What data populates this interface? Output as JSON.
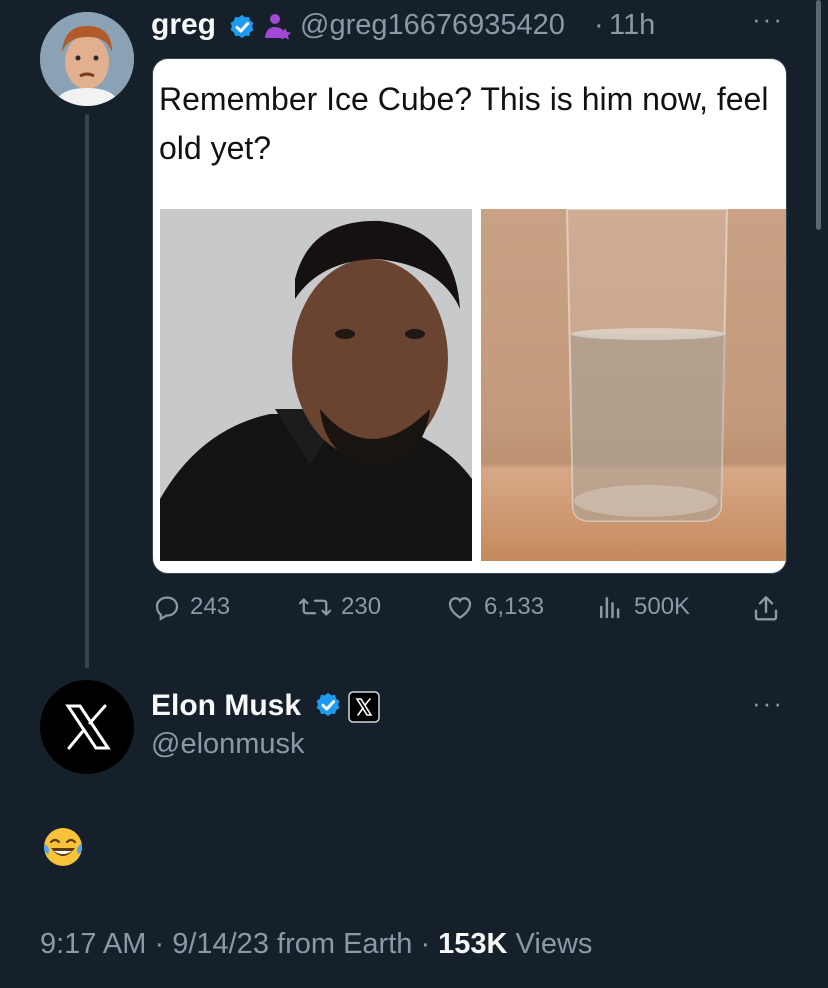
{
  "original_tweet": {
    "author_name": "greg",
    "handle": "@greg16676935420",
    "separator": "·",
    "time_ago": "11h",
    "more_label": "···",
    "media": {
      "caption": "Remember Ice Cube? This is him now, feel old yet?"
    },
    "actions": {
      "replies": "243",
      "retweets": "230",
      "likes": "6,133",
      "views": "500K"
    }
  },
  "reply_tweet": {
    "author_name": "Elon Musk",
    "handle": "@elonmusk",
    "more_label": "···",
    "body_emoji": "😂",
    "footer": {
      "time": "9:17 AM",
      "sep1": " · ",
      "date": "9/14/23",
      "source": " from Earth",
      "sep2": " · ",
      "views_count": "153K",
      "views_label": " Views"
    }
  },
  "colors": {
    "background": "#15202b",
    "muted_text": "#8b98a5",
    "verified_blue": "#1d9bf0",
    "affiliate_purple": "#a149d6"
  },
  "icons": [
    "verified-badge",
    "affiliate-icon",
    "x-logo",
    "reply-icon",
    "retweet-icon",
    "like-icon",
    "views-icon",
    "share-icon",
    "more-icon"
  ]
}
